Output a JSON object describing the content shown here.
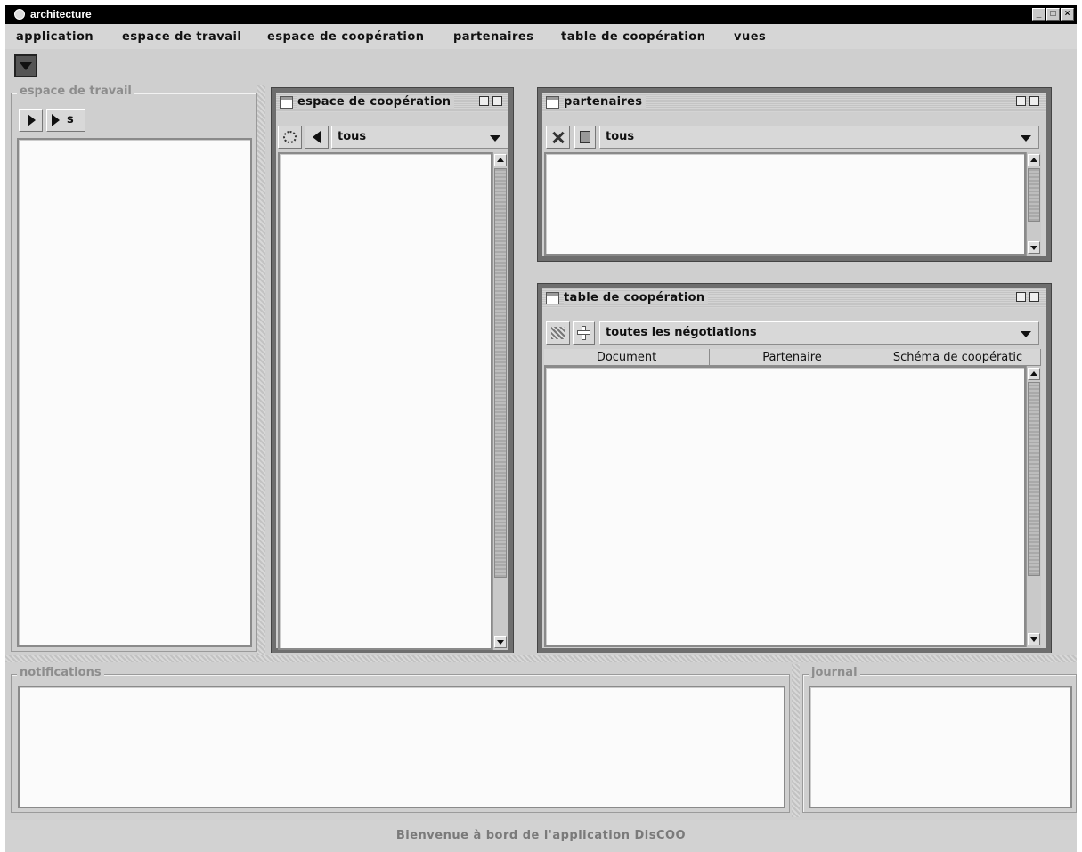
{
  "window": {
    "title": "architecture"
  },
  "menu": [
    "application",
    "espace de travail",
    "espace de coopération",
    "partenaires",
    "table de coopération",
    "vues"
  ],
  "panels": {
    "workspace": {
      "legend": "espace de travail",
      "btn2_label": "s"
    },
    "coop_space": {
      "title": "espace de coopération",
      "filter": "tous"
    },
    "partners": {
      "title": "partenaires",
      "filter": "tous"
    },
    "coop_table": {
      "title": "table de coopération",
      "filter": "toutes les négotiations",
      "columns": [
        "Document",
        "Partenaire",
        "Schéma de coopératic"
      ]
    },
    "notifications": {
      "legend": "notifications"
    },
    "journal": {
      "legend": "journal"
    }
  },
  "status": "Bienvenue à bord de l'application DisCOO"
}
